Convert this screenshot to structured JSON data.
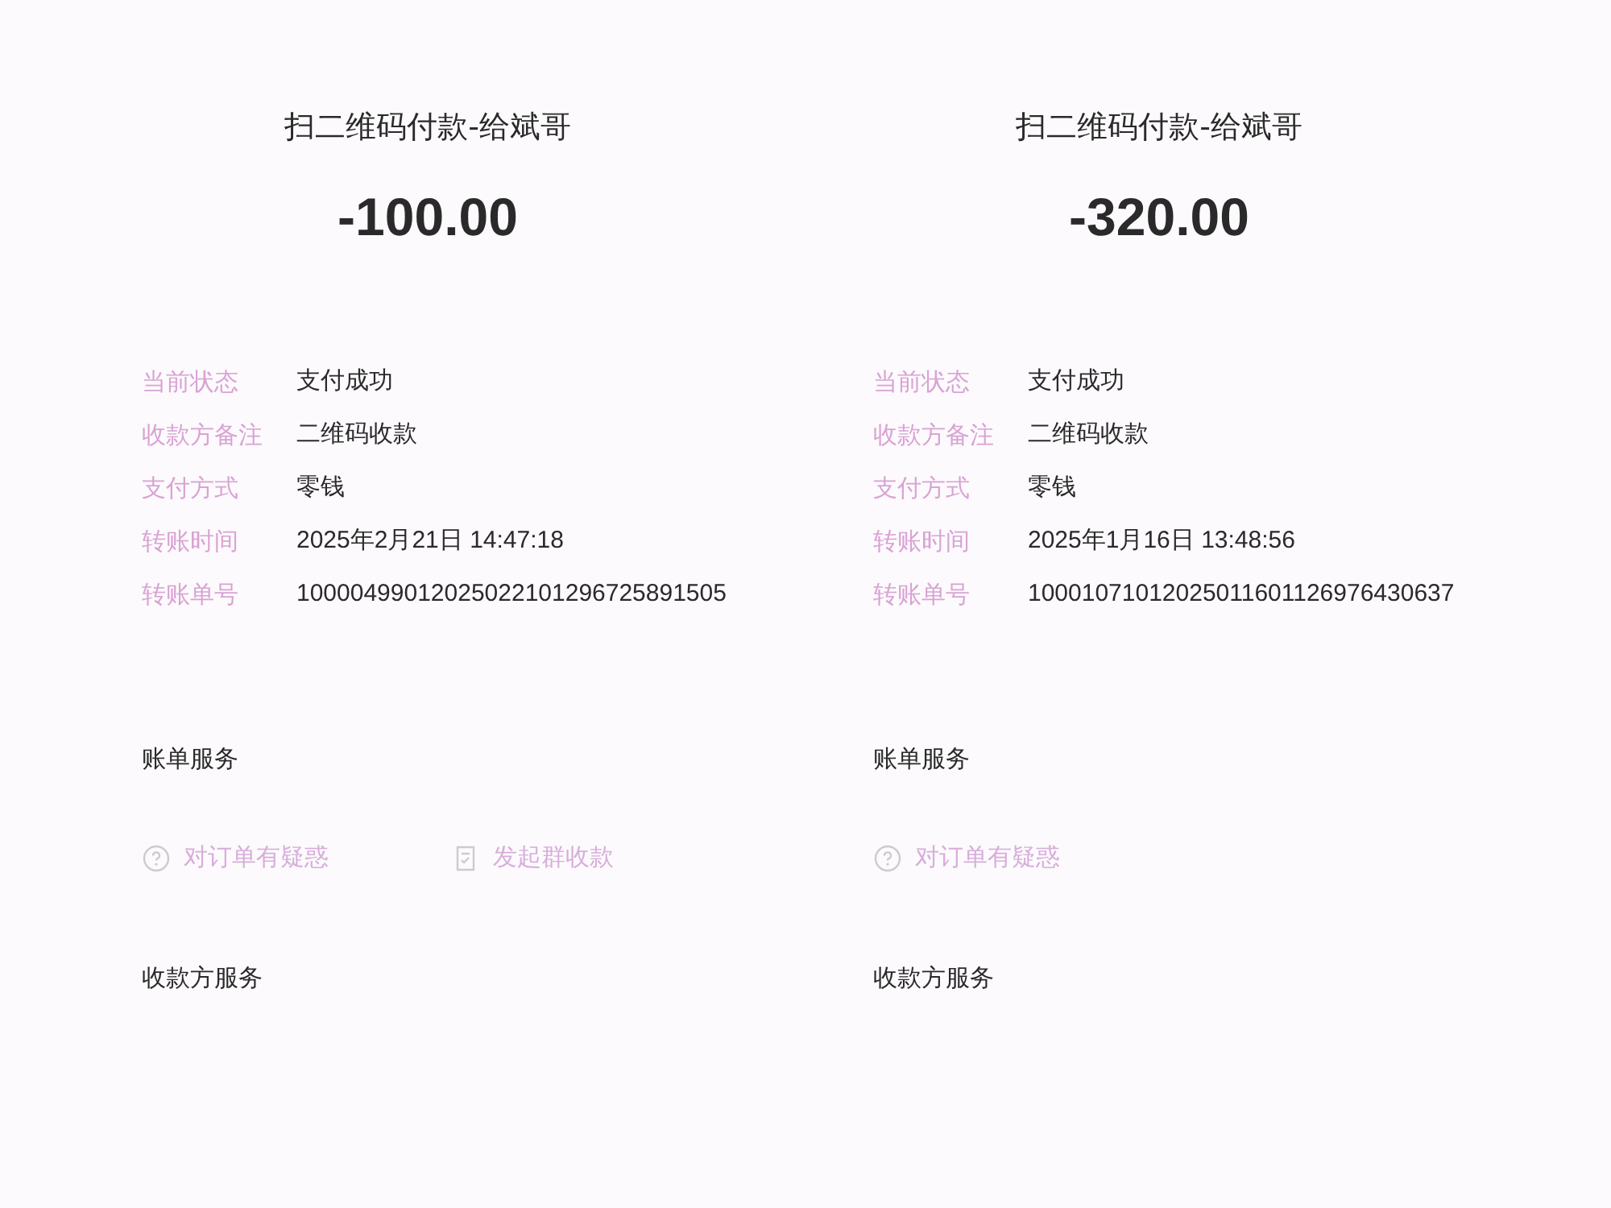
{
  "receipts": [
    {
      "title": "扫二维码付款-给斌哥",
      "amount": "-100.00",
      "details": [
        {
          "label": "当前状态",
          "value": "支付成功"
        },
        {
          "label": "收款方备注",
          "value": "二维码收款"
        },
        {
          "label": "支付方式",
          "value": "零钱"
        },
        {
          "label": "转账时间",
          "value": "2025年2月21日 14:47:18"
        },
        {
          "label": "转账单号",
          "value": "10000499012025022101296725891505"
        }
      ],
      "bill_services_heading": "账单服务",
      "actions": [
        {
          "kind": "question",
          "label": "对订单有疑惑"
        },
        {
          "kind": "split",
          "label": "发起群收款"
        }
      ],
      "payee_services_heading": "收款方服务"
    },
    {
      "title": "扫二维码付款-给斌哥",
      "amount": "-320.00",
      "details": [
        {
          "label": "当前状态",
          "value": "支付成功"
        },
        {
          "label": "收款方备注",
          "value": "二维码收款"
        },
        {
          "label": "支付方式",
          "value": "零钱"
        },
        {
          "label": "转账时间",
          "value": "2025年1月16日 13:48:56"
        },
        {
          "label": "转账单号",
          "value": "10001071012025011601126976430637"
        }
      ],
      "bill_services_heading": "账单服务",
      "actions": [
        {
          "kind": "question",
          "label": "对订单有疑惑"
        }
      ],
      "payee_services_heading": "收款方服务"
    }
  ]
}
